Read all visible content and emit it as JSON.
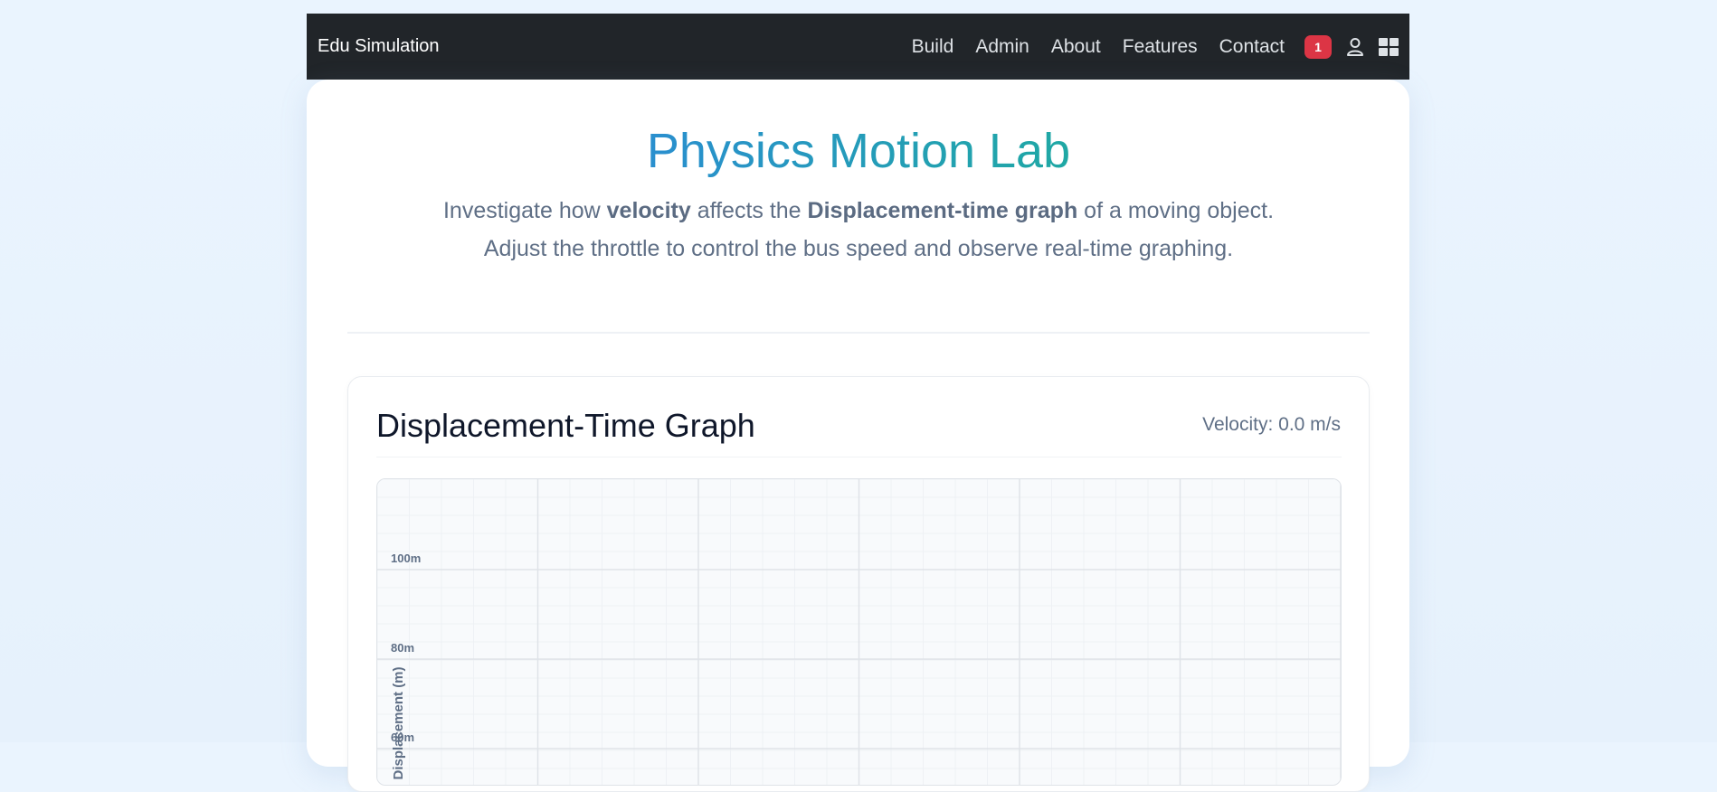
{
  "navbar": {
    "brand": "Edu Simulation",
    "links": [
      "Build",
      "Admin",
      "About",
      "Features",
      "Contact"
    ],
    "notification_count": "1",
    "icons": [
      "user-icon",
      "apps-grid-icon"
    ]
  },
  "hero": {
    "title": "Physics Motion Lab",
    "subtitle_parts": [
      "Investigate how ",
      "velocity",
      " affects the ",
      "Displacement-time graph",
      " of a moving object. Adjust the throttle to control the bus speed and observe real-time graphing."
    ]
  },
  "graph_card": {
    "title": "Displacement-Time Graph",
    "velocity_label": "Velocity: 0.0 m/s"
  },
  "chart_data": {
    "type": "line",
    "ylabel": "Displacement (m)",
    "y_tick_labels": [
      "100m",
      "80m",
      "60m"
    ],
    "series": []
  },
  "colors": {
    "navbar_bg": "#212529",
    "badge": "#dc3545",
    "title_gradient_start": "#2a8fcf",
    "title_gradient_end": "#1fa8a4"
  }
}
